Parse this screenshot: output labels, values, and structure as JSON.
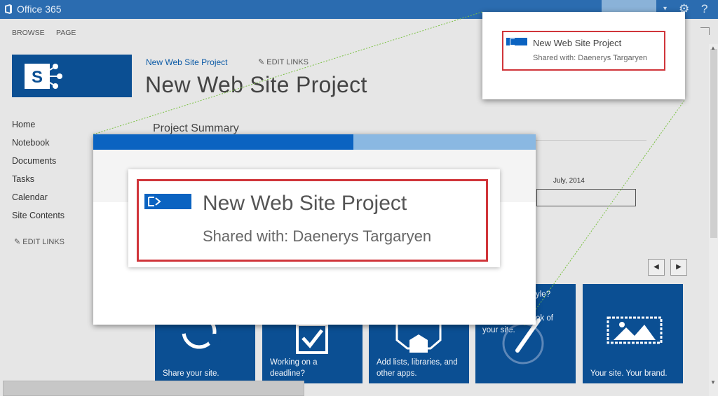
{
  "topbar": {
    "brand": "Office 365"
  },
  "ribbon": {
    "tabs": [
      "BROWSE",
      "PAGE"
    ]
  },
  "header": {
    "site_link": "New Web Site Project",
    "edit_links": "EDIT LINKS",
    "page_title": "New Web Site Project"
  },
  "nav": {
    "items": [
      "Home",
      "Notebook",
      "Documents",
      "Tasks",
      "Calendar",
      "Site Contents"
    ],
    "edit_links": "EDIT LINKS"
  },
  "main": {
    "summary_title": "Project Summary",
    "timeline_date": "July, 2014"
  },
  "tiles": [
    {
      "label": "Share your site."
    },
    {
      "label": "Working on a deadline?"
    },
    {
      "label": "Add lists, libraries, and other apps."
    },
    {
      "label": "Your site. Your brand."
    }
  ],
  "tile_partial_text": [
    "yle?",
    "ok of",
    "your site."
  ],
  "share_popup": {
    "title": "New Web Site Project",
    "shared_with": "Shared with: Daenerys Targaryen"
  },
  "zoom_popup": {
    "title": "New Web Site Project",
    "shared_with": "Shared with: Daenerys Targaryen"
  },
  "colors": {
    "suite_bar": "#2b6cb0",
    "tile_blue": "#0b4f93",
    "highlight_red": "#d0353a",
    "link_blue": "#0b5aa6"
  },
  "icons": [
    "office-logo-icon",
    "gear-icon",
    "help-icon",
    "pencil-icon",
    "sharepoint-logo-icon",
    "share-icon",
    "checkmark-icon",
    "app-icon",
    "brush-icon",
    "image-icon",
    "prev-arrow-icon",
    "next-arrow-icon"
  ]
}
